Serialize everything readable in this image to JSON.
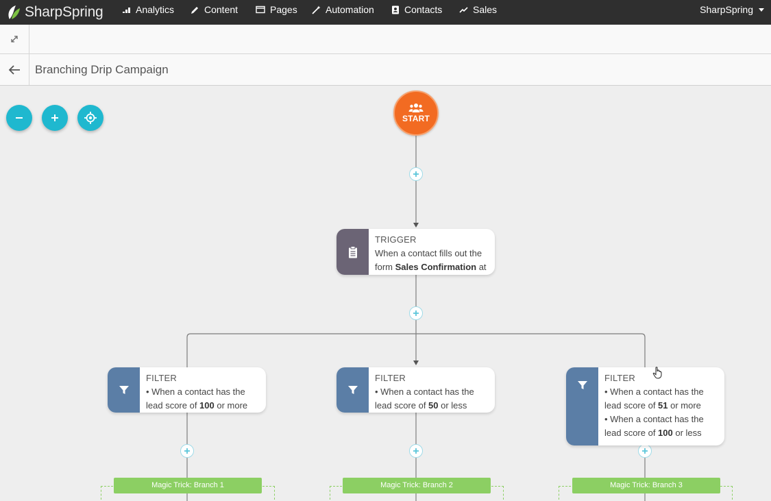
{
  "app": {
    "brand": "SharpSpring",
    "account": "SharpSpring"
  },
  "nav": [
    {
      "label": "Analytics",
      "icon": "analytics-icon"
    },
    {
      "label": "Content",
      "icon": "pencil-icon"
    },
    {
      "label": "Pages",
      "icon": "window-icon"
    },
    {
      "label": "Automation",
      "icon": "wand-icon"
    },
    {
      "label": "Contacts",
      "icon": "contacts-icon"
    },
    {
      "label": "Sales",
      "icon": "sales-chart-icon"
    }
  ],
  "page": {
    "title": "Branching Drip Campaign"
  },
  "canvas_controls": [
    {
      "name": "zoom-out",
      "icon": "minus-icon"
    },
    {
      "name": "zoom-in",
      "icon": "plus-icon"
    },
    {
      "name": "recenter",
      "icon": "target-icon"
    }
  ],
  "workflow": {
    "start": {
      "label": "START",
      "icon": "users-icon",
      "color": "#f26b22"
    },
    "trigger": {
      "type": "TRIGGER",
      "line1": "When a contact fills out the",
      "line2_prefix": "form ",
      "line2_bold": "Sales Confirmation",
      "line2_suffix": " at",
      "icon": "clipboard-icon",
      "color": "#6b6475"
    },
    "filters": [
      {
        "type": "FILTER",
        "icon": "funnel-icon",
        "color": "#5b7ea6",
        "conditions": [
          {
            "line1": "• When a contact has the",
            "prefix": "lead score of ",
            "bold": "100",
            "suffix": " or more"
          }
        ]
      },
      {
        "type": "FILTER",
        "icon": "funnel-icon",
        "color": "#5b7ea6",
        "conditions": [
          {
            "line1": "• When a contact has the",
            "prefix": "lead score of ",
            "bold": "50",
            "suffix": " or less"
          }
        ]
      },
      {
        "type": "FILTER",
        "icon": "funnel-icon",
        "color": "#5b7ea6",
        "conditions": [
          {
            "line1": "• When a contact has the",
            "prefix": "lead score of ",
            "bold": "51",
            "suffix": " or more"
          },
          {
            "line1": "• When a contact has the",
            "prefix": "lead score of ",
            "bold": "100",
            "suffix": " or less"
          }
        ]
      }
    ],
    "branches": [
      {
        "label": "Magic Trick: Branch 1"
      },
      {
        "label": "Magic Trick: Branch 2"
      },
      {
        "label": "Magic Trick: Branch 3"
      }
    ],
    "branch_color": "#8ccf63",
    "accent": "#1fb8cf"
  }
}
